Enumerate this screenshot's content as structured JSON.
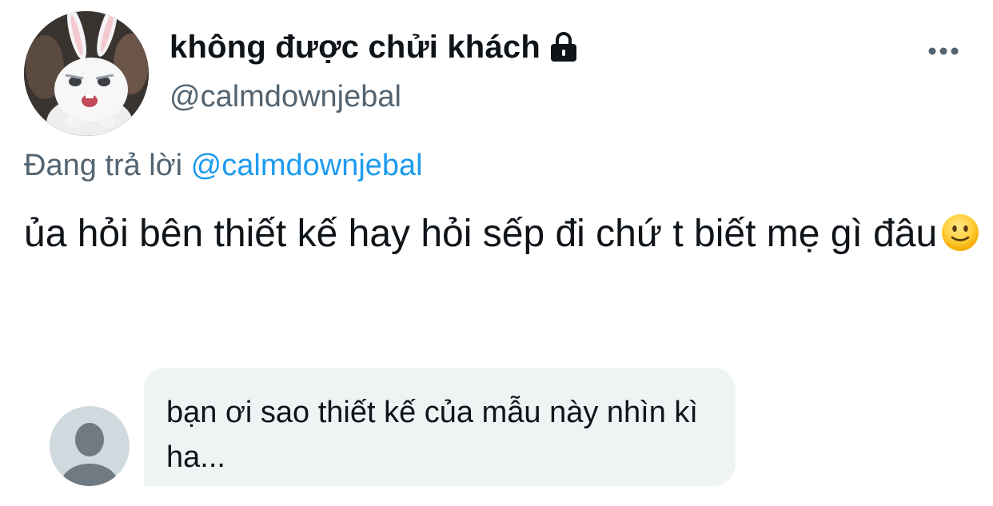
{
  "profile": {
    "display_name": "không được chửi khách",
    "handle": "@calmdownjebal",
    "avatar_icon": "rabbit-avatar",
    "locked_icon": "lock-icon",
    "more_icon": "more-horizontal-icon"
  },
  "reply": {
    "prefix": "Đang trả lời",
    "mention": "@calmdownjebal"
  },
  "tweet": {
    "text": "ủa hỏi bên thiết kế hay hỏi sếp đi chứ t biết mẹ gì đâu",
    "emoji": "slightly-smiling-face"
  },
  "quoted_message": {
    "avatar_icon": "default-user-icon",
    "text": "bạn ơi sao thiết kế của mẫu này nhìn kì ha..."
  },
  "colors": {
    "text": "#0f1419",
    "secondary_text": "#536471",
    "link": "#1d9bf0",
    "bubble_background": "#eff3f4",
    "placeholder_avatar": "#cfd9de",
    "placeholder_figure": "#6f7a82"
  }
}
